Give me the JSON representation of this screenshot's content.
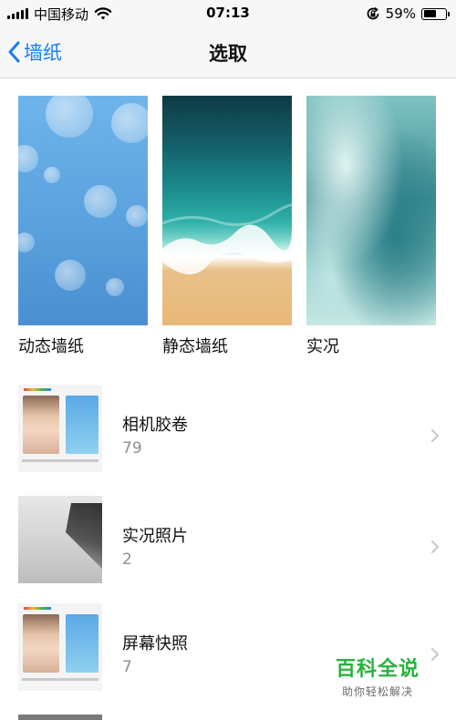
{
  "status_bar": {
    "carrier": "中国移动",
    "time": "07:13",
    "battery_percent": "59%",
    "battery_level": 0.59
  },
  "nav": {
    "back_label": "墙纸",
    "title": "选取"
  },
  "wallpapers": [
    {
      "label": "动态墙纸"
    },
    {
      "label": "静态墙纸"
    },
    {
      "label": "实况"
    }
  ],
  "albums": [
    {
      "title": "相机胶卷",
      "count": "79"
    },
    {
      "title": "实况照片",
      "count": "2"
    },
    {
      "title": "屏幕快照",
      "count": "7"
    }
  ],
  "watermark": {
    "title": "百科全说",
    "subtitle": "助你轻松解决"
  },
  "colors": {
    "accent": "#1a7ef6",
    "watermark_green": "#27b33b"
  },
  "icons": {
    "back": "chevron-left-icon",
    "row_disclosure": "chevron-right-icon",
    "wifi": "wifi-icon",
    "orientation_lock": "rotation-lock-icon",
    "battery": "battery-icon"
  }
}
